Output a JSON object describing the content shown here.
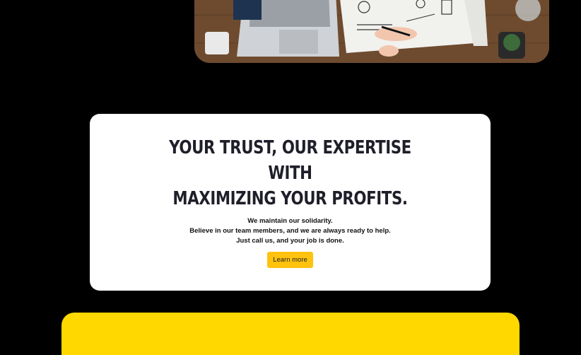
{
  "hero": {
    "image_icon": "desk-workspace-photo-icon"
  },
  "card": {
    "heading_lines": [
      "Your trust, our expertise",
      "with",
      "maximizing your profits."
    ],
    "body_lines": [
      "We maintain our solidarity.",
      "Believe in our team members, and we are always ready to help.",
      "Just call us, and your job is done."
    ],
    "button_label": "Learn more"
  },
  "colors": {
    "background": "#000000",
    "card": "#ffffff",
    "accent": "#ffc20e",
    "panel": "#ffd800"
  }
}
